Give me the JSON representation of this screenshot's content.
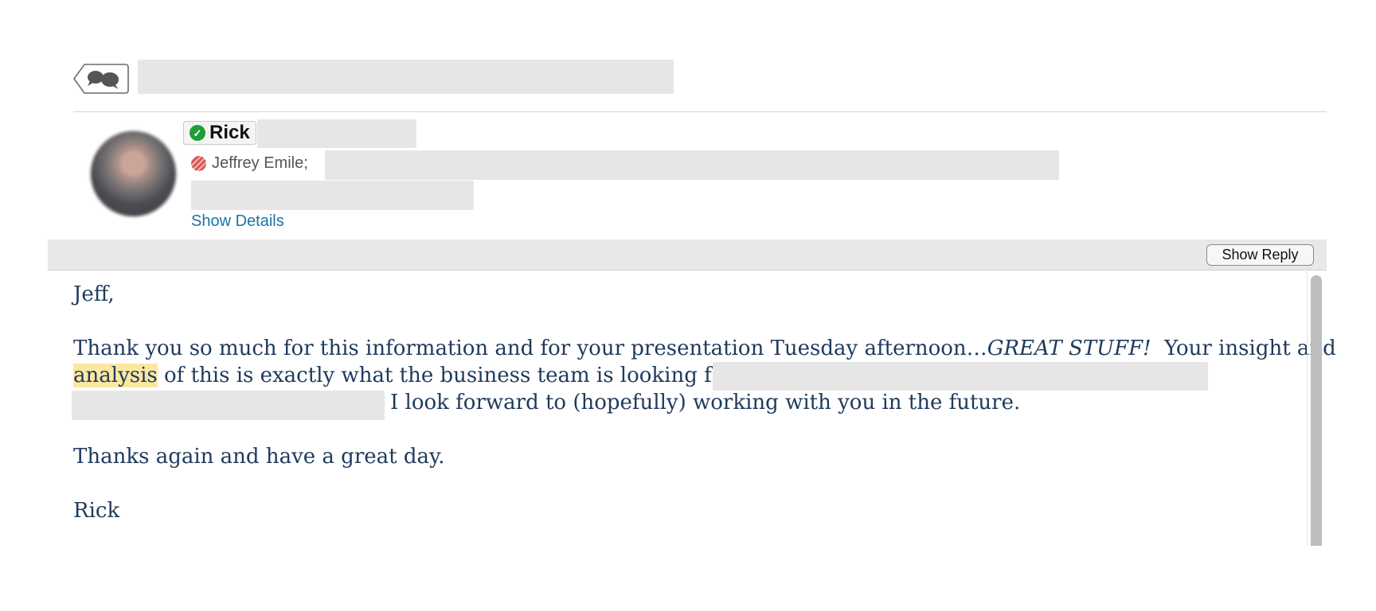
{
  "header": {
    "conversation_icon": "conversation-bubbles-icon"
  },
  "sender": {
    "name": "Rick",
    "status_icon": "online-check-icon",
    "status_color": "#1f9d36"
  },
  "recipients": {
    "to_name": "Jeffrey Emile;",
    "status_icon": "busy-status-icon",
    "status_color": "#d9534f"
  },
  "actions": {
    "show_details": "Show Details",
    "show_reply": "Show Reply"
  },
  "message": {
    "greeting": "Jeff,",
    "p1_part1": "Thank you so much for this information and for your presentation Tuesday afternoon…",
    "p1_emphasis": "GREAT STUFF!",
    "p1_part2": "  Your insight and",
    "p1_highlight": "analysis",
    "p1_part3": " of this is exactly what the business team is looking for!",
    "p1_part4": "I look forward to (hopefully) working with you in the future.",
    "p2": "Thanks again and have a great day.",
    "signoff": "Rick"
  },
  "colors": {
    "body_text": "#1f3a5c",
    "link": "#1a73a8",
    "highlight": "#fbe7a1"
  }
}
